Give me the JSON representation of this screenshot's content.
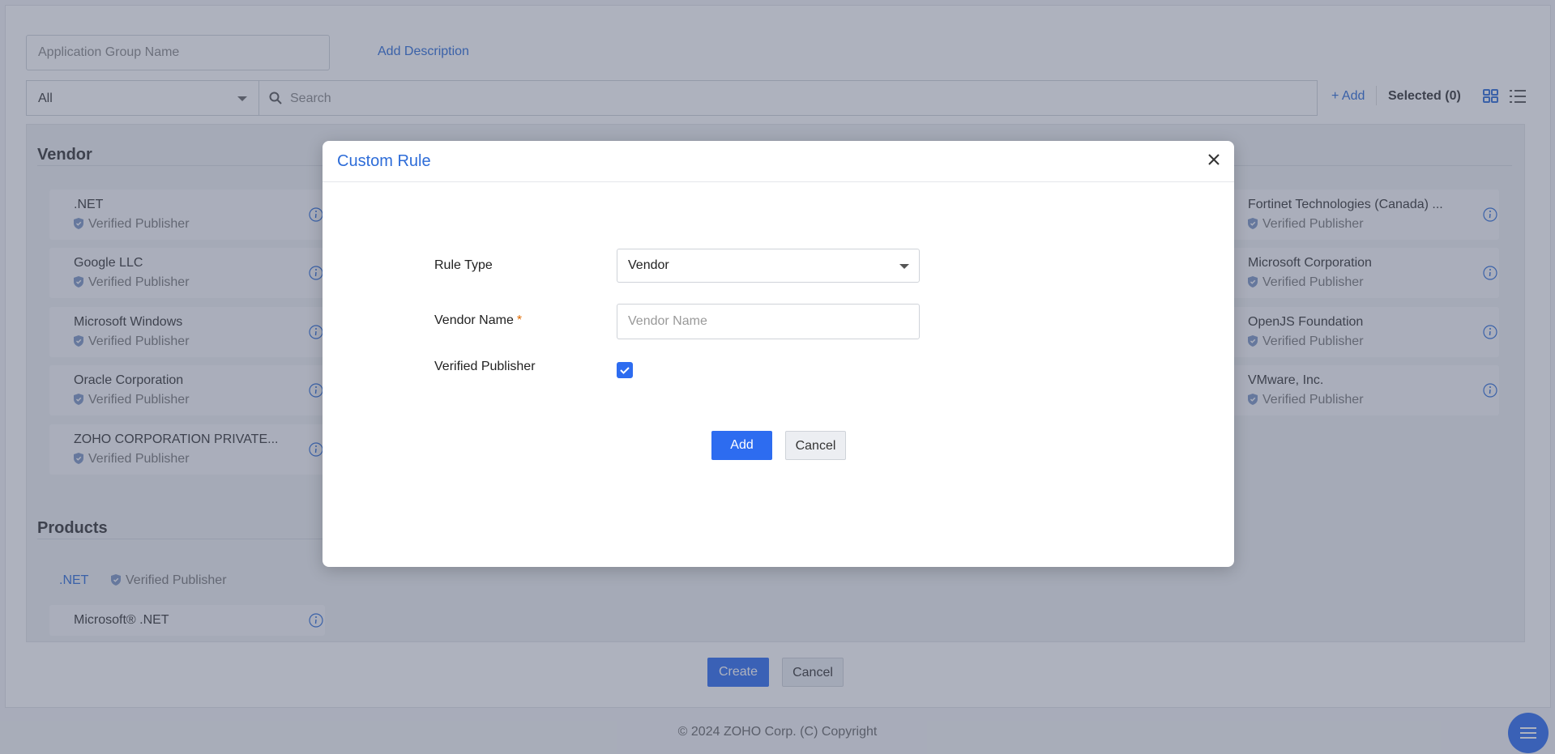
{
  "form": {
    "group_name_placeholder": "Application Group Name",
    "add_description": "Add Description",
    "filter_value": "All",
    "search_placeholder": "Search",
    "add_link": "+ Add",
    "selected_label": "Selected (0)"
  },
  "vendor_section": {
    "title": "Vendor",
    "cards": [
      {
        "name": ".NET",
        "publisher": "Verified Publisher"
      },
      {
        "name": "Google LLC",
        "publisher": "Verified Publisher"
      },
      {
        "name": "Microsoft Windows",
        "publisher": "Verified Publisher"
      },
      {
        "name": "Oracle Corporation",
        "publisher": "Verified Publisher"
      },
      {
        "name": "ZOHO CORPORATION PRIVATE...",
        "publisher": "Verified Publisher"
      },
      {
        "name": "Fortinet Technologies (Canada) ...",
        "publisher": "Verified Publisher"
      },
      {
        "name": "Microsoft Corporation",
        "publisher": "Verified Publisher"
      },
      {
        "name": "OpenJS Foundation",
        "publisher": "Verified Publisher"
      },
      {
        "name": "VMware, Inc.",
        "publisher": "Verified Publisher"
      }
    ]
  },
  "products_section": {
    "title": "Products",
    "vendor_tag": ".NET",
    "vendor_publisher": "Verified Publisher",
    "cards": [
      {
        "name": "Microsoft® .NET"
      }
    ]
  },
  "page_actions": {
    "create": "Create",
    "cancel": "Cancel"
  },
  "footer": {
    "copyright": "© 2024 ZOHO Corp. (C) Copyright"
  },
  "modal": {
    "title": "Custom Rule",
    "rule_type_label": "Rule Type",
    "rule_type_value": "Vendor",
    "vendor_name_label": "Vendor Name",
    "vendor_name_required": "*",
    "vendor_name_placeholder": "Vendor Name",
    "verified_publisher_label": "Verified Publisher",
    "verified_publisher_checked": true,
    "add_button": "Add",
    "cancel_button": "Cancel"
  },
  "colors": {
    "accent": "#2d6cf0",
    "link": "#2d6cd8",
    "required": "#e06a00"
  }
}
